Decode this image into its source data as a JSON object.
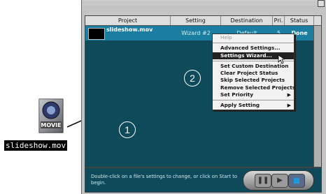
{
  "table": {
    "headers": [
      "Project",
      "Setting",
      "Destination",
      "Pri.",
      "Status"
    ],
    "rows": [
      {
        "project": "slideshow.mov",
        "setting": "Wizard #2",
        "destination": "Default",
        "priority": "5",
        "status": "Done"
      }
    ]
  },
  "context_menu": {
    "items": [
      {
        "label": "Help",
        "disabled": true
      },
      {
        "label": "Advanced Settings..."
      },
      {
        "label": "Settings Wizard...",
        "selected": true
      },
      {
        "label": "Set Custom Destination"
      },
      {
        "label": "Clear Project Status"
      },
      {
        "label": "Skip Selected Projects"
      },
      {
        "label": "Remove Selected Projects"
      },
      {
        "label": "Set Priority",
        "submenu": true
      },
      {
        "label": "Apply Setting",
        "submenu": true
      }
    ]
  },
  "callouts": {
    "one": "1",
    "two": "2"
  },
  "hint_text": "Double-click on a file's settings to change, or click on Start to begin.",
  "desktop_file": {
    "label": "slideshow.mov",
    "icon_text": "MOVIE",
    "icon": "movie-file-icon"
  },
  "controls": {
    "pause": "pause-icon",
    "play": "play-icon",
    "stop": "stop-icon"
  },
  "colors": {
    "panel": "#0f4a5a",
    "row_selected": "#1b7da0",
    "window": "#c4c4c4"
  }
}
